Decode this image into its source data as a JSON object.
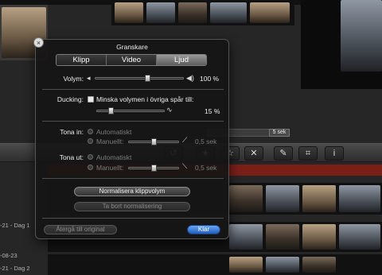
{
  "hud": {
    "title": "Granskare",
    "tabs": [
      {
        "label": "Klipp",
        "selected": false
      },
      {
        "label": "Video",
        "selected": false
      },
      {
        "label": "Ljud",
        "selected": true
      }
    ],
    "volume": {
      "label": "Volym:",
      "value": "100 %",
      "level": 0.6
    },
    "ducking": {
      "label": "Ducking:",
      "checkbox_label": "Minska volymen i övriga spår till:",
      "value": "15 %",
      "level": 0.18
    },
    "fade_in": {
      "label": "Tona in:",
      "auto": "Automatiskt",
      "manual": "Manuellt:",
      "value": "0,5 sek",
      "level": 0.5
    },
    "fade_out": {
      "label": "Tona ut:",
      "auto": "Automatiskt",
      "manual": "Manuellt:",
      "value": "0,5 sek",
      "level": 0.5
    },
    "normalize_button": "Normalisera klippvolym",
    "remove_normalize_button": "Ta bort normalisering",
    "revert_button": "Återgå till original",
    "done_button": "Klar"
  },
  "background": {
    "timeline_label": "5 sek",
    "events": [
      "-21 - Dag 1",
      "-08-23",
      "-21 - Dag 2"
    ],
    "tool_icons": [
      "rotate-icon",
      "star-icon",
      "star-outline-icon",
      "reject-icon",
      "microphone-icon",
      "crop-icon",
      "info-icon"
    ]
  },
  "colors": {
    "accent": "#2b6fd6",
    "panel": "#161616",
    "audio_wave": "#c0392b"
  }
}
